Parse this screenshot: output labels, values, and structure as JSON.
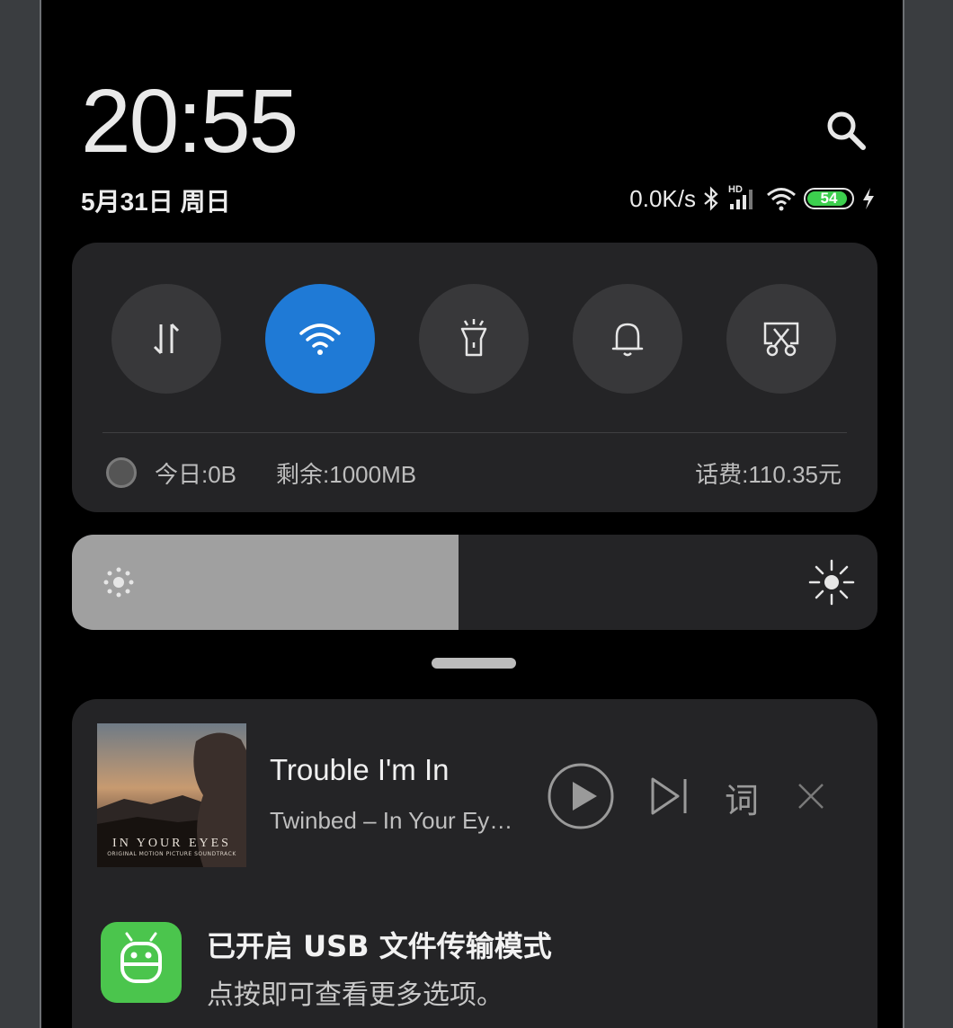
{
  "header": {
    "time": "20:55",
    "date": "5月31日 周日",
    "net_speed": "0.0K/s",
    "signal_tag": "HD",
    "battery_level": "54"
  },
  "quick_settings": {
    "toggles": [
      {
        "icon": "data-transfer-icon",
        "active": false
      },
      {
        "icon": "wifi-icon",
        "active": true
      },
      {
        "icon": "flashlight-icon",
        "active": false
      },
      {
        "icon": "bell-icon",
        "active": false
      },
      {
        "icon": "screenshot-icon",
        "active": false
      }
    ],
    "data_usage": {
      "today": "今日:0B",
      "remaining": "剩余:1000MB",
      "balance": "话费:110.35元"
    }
  },
  "brightness": {
    "level_fraction": 0.48
  },
  "media": {
    "title": "Trouble I'm In",
    "artist": "Twinbed – In Your Ey…",
    "album_art_title": "IN YOUR EYES",
    "album_art_subtitle": "ORIGINAL MOTION PICTURE SOUNDTRACK",
    "lyrics_label": "词"
  },
  "usb_notification": {
    "title": "已开启 USB 文件传输模式",
    "subtitle": "点按即可查看更多选项。"
  },
  "colors": {
    "accent": "#1f7ad6",
    "panel": "#242426",
    "battery": "#3ccf4e",
    "usb_icon": "#4bc54d"
  }
}
